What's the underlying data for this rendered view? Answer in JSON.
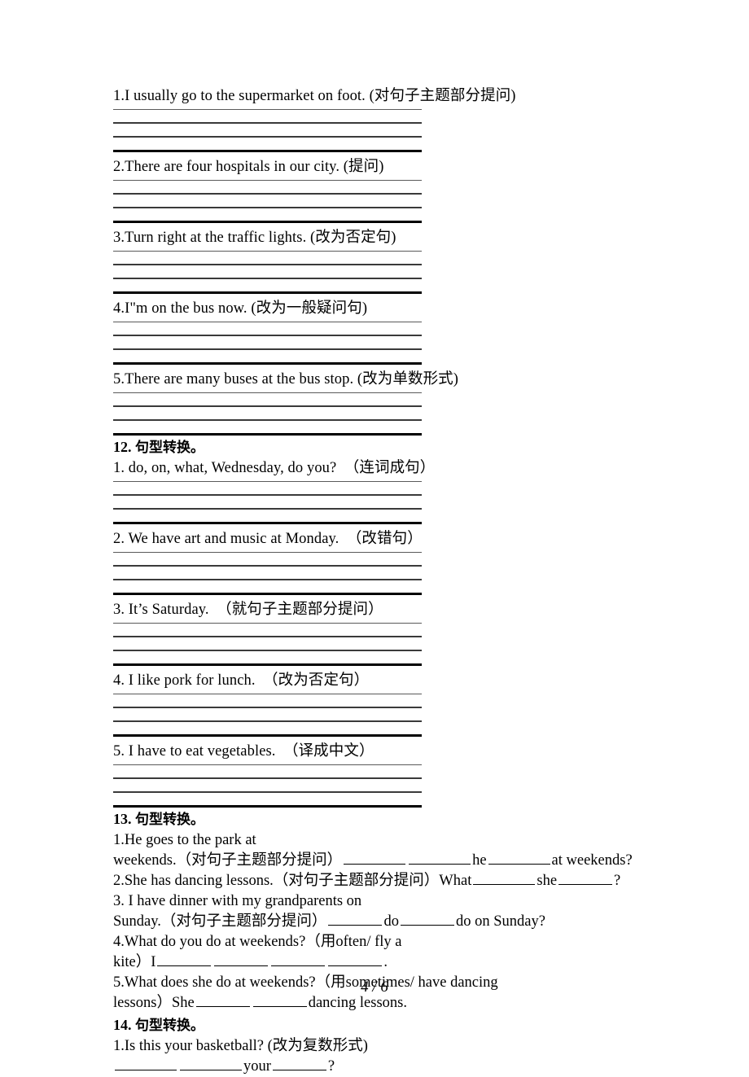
{
  "page": {
    "footer_label": "4 / 6",
    "background_color": "#ffffff",
    "text_color": "#000000"
  },
  "sections": [
    {
      "id": "section-11-continued",
      "heading": null,
      "items": [
        {
          "number": "1.",
          "text": "1.I usually go to the supermarket on foot. (对句子主题部分提问)",
          "answer_lines": 4
        },
        {
          "number": "2.",
          "text": "2.There are four hospitals in our city. (提问)",
          "answer_lines": 4
        },
        {
          "number": "3.",
          "text": "3.Turn right at the traffic lights. (改为否定句)",
          "answer_lines": 4
        },
        {
          "number": "4.",
          "text": "4.I\"m on the bus now. (改为一般疑问句)",
          "answer_lines": 4
        },
        {
          "number": "5.",
          "text": "5.There are many buses at the bus stop. (改为单数形式)",
          "answer_lines": 4
        }
      ]
    },
    {
      "id": "section-12",
      "heading": "12. 句型转换。",
      "heading_number": "12.",
      "heading_text": "句型转换。",
      "items": [
        {
          "number": "1.",
          "text": "1. do, on, what, Wednesday, do you?  （连词成句）",
          "answer_lines": 4
        },
        {
          "number": "2.",
          "text": "2. We have art and music at Monday.  （改错句）",
          "answer_lines": 4
        },
        {
          "number": "3.",
          "text": "3. It’s Saturday.  （就句子主题部分提问）",
          "answer_lines": 4
        },
        {
          "number": "4.",
          "text": "4. I like pork for lunch.  （改为否定句）",
          "answer_lines": 4
        },
        {
          "number": "5.",
          "text": "5. I have to eat vegetables.  （译成中文）",
          "answer_lines": 4
        }
      ]
    },
    {
      "id": "section-13",
      "heading": "13. 句型转换。",
      "heading_number": "13.",
      "heading_text": "句型转换。",
      "items": [
        {
          "number": "1.",
          "line1": "1.He goes to the park at",
          "line2_pre": "weekends.（对句子主题部分提问）",
          "line2_mid_1": "he",
          "line2_tail": "at weekends?"
        },
        {
          "number": "2.",
          "line1_pre": "2.She has dancing lessons.（对句子主题部分提问）What",
          "line1_mid": "she",
          "line1_tail": "?"
        },
        {
          "number": "3.",
          "line1": "3. I have dinner with my grandparents on",
          "line2_pre": "Sunday.（对句子主题部分提问）",
          "line2_mid": "do",
          "line2_tail": "do on Sunday?"
        },
        {
          "number": "4.",
          "line1": "4.What do you do at weekends?（用often/ fly a",
          "line2_pre": "kite）I",
          "line2_tail": "."
        },
        {
          "number": "5.",
          "line1": "5.What does she do at weekends?（用sometimes/ have dancing",
          "line2_pre": "lessons）She",
          "line2_tail": "dancing lessons."
        }
      ]
    },
    {
      "id": "section-14",
      "heading": "14. 句型转换。",
      "heading_number": "14.",
      "heading_text": "句型转换。",
      "items": [
        {
          "number": "1.",
          "line1": "1.Is this your basketball? (改为复数形式)",
          "line2_mid": "your",
          "line2_tail": "?"
        }
      ]
    }
  ]
}
